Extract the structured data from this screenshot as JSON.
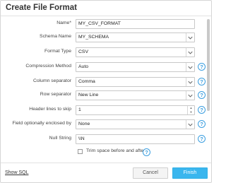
{
  "dialog": {
    "title": "Create File Format"
  },
  "fields": {
    "name": {
      "label": "Name",
      "required_mark": "*",
      "value": "MY_CSV_FORMAT"
    },
    "schema_name": {
      "label": "Schema Name",
      "value": "MY_SCHEMA"
    },
    "format_type": {
      "label": "Format Type",
      "value": "CSV"
    },
    "compression_method": {
      "label": "Compression Method",
      "value": "Auto"
    },
    "column_separator": {
      "label": "Column separator",
      "value": "Comma"
    },
    "row_separator": {
      "label": "Row separator",
      "value": "New Line"
    },
    "header_lines": {
      "label": "Header lines to skip",
      "value": "1"
    },
    "enclosed_by": {
      "label": "Field optionally enclosed by",
      "value": "None"
    },
    "null_string": {
      "label": "Null String",
      "value": "\\\\N"
    },
    "trim_space": {
      "label": "Trim space before and after",
      "checked": false
    }
  },
  "help_glyph": "?",
  "footer": {
    "show_sql": "Show SQL",
    "cancel": "Cancel",
    "finish": "Finish"
  },
  "colors": {
    "accent": "#3ab6ee",
    "help": "#3c9fe0"
  }
}
